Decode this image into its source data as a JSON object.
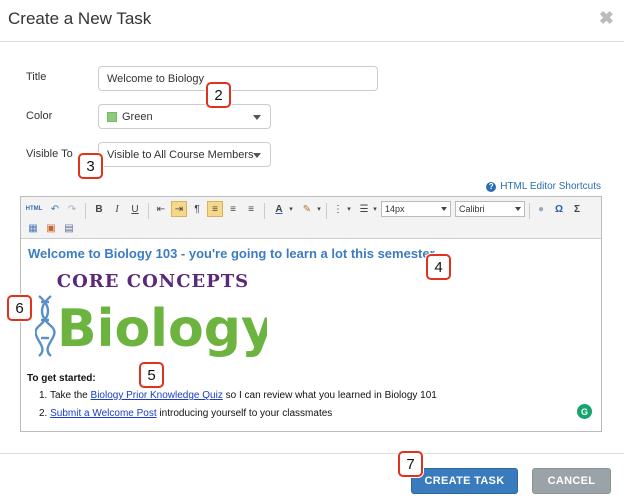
{
  "dialog": {
    "title": "Create a New Task",
    "close_glyph": "✖"
  },
  "form": {
    "title_label": "Title",
    "title_value": "Welcome to Biology",
    "color_label": "Color",
    "color_value": "Green",
    "color_swatch": "#8fc97a",
    "visible_label": "Visible To",
    "visible_value": "Visible to All Course Members"
  },
  "editor": {
    "shortcuts_label": "HTML Editor Shortcuts",
    "font_size": "14px",
    "font_family": "Calibri",
    "heading": "Welcome to Biology 103 - you're going to learn a lot this semester.",
    "logo_top": "CORE CONCEPTS",
    "logo_main": "Biology",
    "get_started": "To get started:",
    "item1_prefix": "1. Take the ",
    "item1_link": "Biology Prior Knowledge Quiz",
    "item1_suffix": " so I can review what you learned in Biology 101",
    "item2_prefix": "2. ",
    "item2_link": "Submit a Welcome Post",
    "item2_suffix": " introducing yourself to your classmates"
  },
  "badges": [
    "2",
    "3",
    "4",
    "5",
    "6",
    "7"
  ],
  "footer": {
    "create_label": "CREATE TASK",
    "cancel_label": "CANCEL"
  },
  "colors": {
    "accent": "#3a7bbd",
    "heading": "#3b7cc4",
    "badge_border": "#e0321c",
    "logo_purple": "#5a2a7a",
    "logo_green": "#6cb33f"
  }
}
